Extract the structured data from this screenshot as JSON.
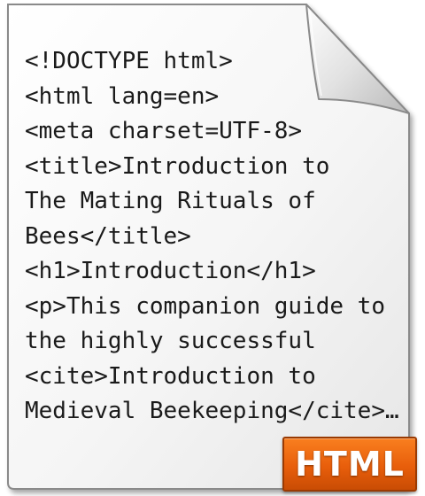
{
  "document": {
    "code_lines": [
      "<!DOCTYPE html>",
      "<html lang=en>",
      "<meta charset=UTF-8>",
      "<title>Introduction to",
      "The Mating Rituals of",
      "Bees</title>",
      "<h1>Introduction</h1>",
      "<p>This companion guide to",
      "the highly successful",
      "<cite>Introduction to",
      "Medieval Beekeeping</cite>…"
    ],
    "icon": "html-file-icon"
  },
  "badge": {
    "label": "HTML",
    "color": "#ee6a12"
  },
  "colors": {
    "page": "#f4f4f4",
    "page_border": "#8a8a8a",
    "text": "#1a1a1a"
  }
}
